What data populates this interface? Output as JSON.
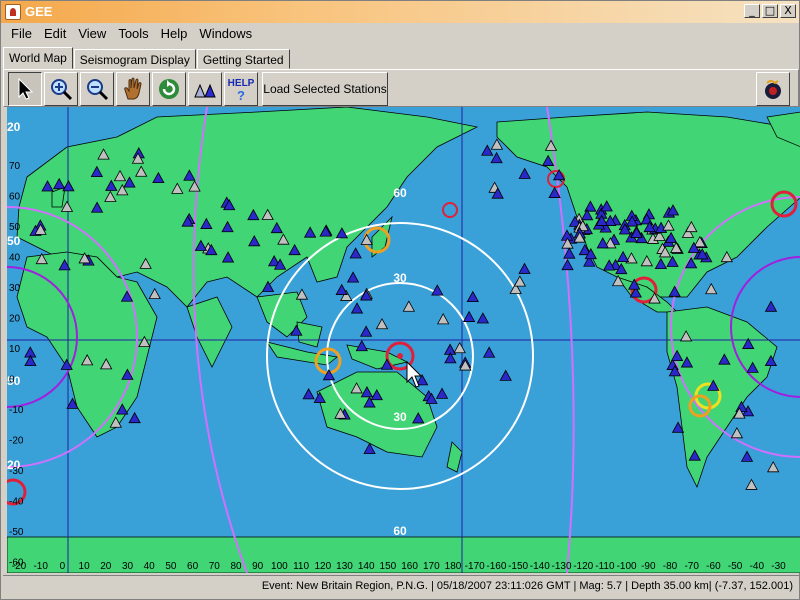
{
  "window": {
    "title": "GEE",
    "minimize": "_",
    "maximize": "□",
    "close": "X"
  },
  "menu": [
    "File",
    "Edit",
    "View",
    "Tools",
    "Help",
    "Windows"
  ],
  "tabs": [
    "World Map",
    "Seismogram Display",
    "Getting Started"
  ],
  "toolbar": {
    "tools": [
      "pointer-icon",
      "zoom-in-icon",
      "zoom-out-icon",
      "pan-hand-icon",
      "refresh-icon",
      "stations-icon",
      "help-icon"
    ],
    "help_label": "HELP",
    "load_label": "Load Selected Stations",
    "right_icon": "earthquake-app-icon"
  },
  "map": {
    "ocean_color": "#3aa0d8",
    "land_color": "#41d576",
    "lat_labels": [
      "70",
      "60",
      "50",
      "40",
      "30",
      "20",
      "10",
      "0",
      "-10",
      "-20",
      "-30",
      "-40",
      "-50",
      "-60",
      "-70"
    ],
    "lon_labels": [
      "-20",
      "-10",
      "0",
      "10",
      "20",
      "30",
      "40",
      "50",
      "60",
      "70",
      "80",
      "90",
      "100",
      "110",
      "120",
      "130",
      "140",
      "150",
      "160",
      "170",
      "180",
      "-170",
      "-160",
      "-150",
      "-140",
      "-130",
      "-120",
      "-110",
      "-100",
      "-90",
      "-80",
      "-70",
      "-60",
      "-50",
      "-40",
      "-30"
    ],
    "ring_labels": [
      "30",
      "30",
      "60",
      "60"
    ],
    "edge_labels": [
      "20",
      "50",
      "50",
      "20"
    ]
  },
  "status": "Event: New Britain Region, P.N.G. | 05/18/2007 23:11:026 GMT | Mag: 5.7 | Depth 35.00 km| (-7.37, 152.001)"
}
